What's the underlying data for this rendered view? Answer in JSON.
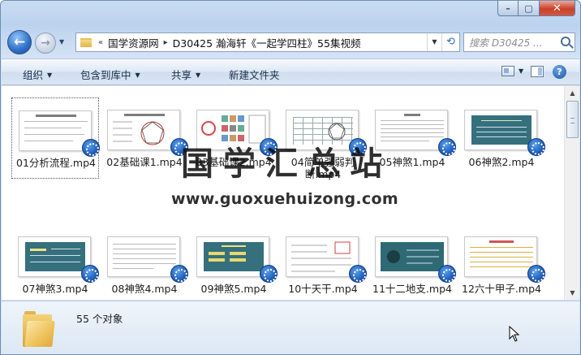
{
  "window": {
    "caption": {
      "minimize": "–",
      "maximize": "▢",
      "close": "✕"
    }
  },
  "nav": {
    "back_glyph": "←",
    "forward_glyph": "→",
    "breadcrumb": [
      "«",
      "国学资源网",
      "D30425 瀚海轩《一起学四柱》55集视频"
    ],
    "breadcrumb_sep": "▸",
    "refresh_glyph": "⟲",
    "search_placeholder": "搜索 D30425 ..."
  },
  "toolbar": {
    "organize": "组织",
    "include_in_library": "包含到库中",
    "share": "共享",
    "new_folder": "新建文件夹",
    "help": "?"
  },
  "files": [
    {
      "name": "01分析流程.mp4",
      "thumb": "text"
    },
    {
      "name": "02基础课1.mp4",
      "thumb": "diagram"
    },
    {
      "name": "03基础课2.mp4",
      "thumb": "grid"
    },
    {
      "name": "04简单强弱判断.mp4",
      "thumb": "grid"
    },
    {
      "name": "05神煞1.mp4",
      "thumb": "text"
    },
    {
      "name": "06神煞2.mp4",
      "thumb": "teal"
    },
    {
      "name": "07神煞3.mp4",
      "thumb": "teal"
    },
    {
      "name": "08神煞4.mp4",
      "thumb": "text"
    },
    {
      "name": "09神煞5.mp4",
      "thumb": "teal"
    },
    {
      "name": "10十天干.mp4",
      "thumb": "text"
    },
    {
      "name": "11十二地支.mp4",
      "thumb": "teal"
    },
    {
      "name": "12六十甲子.mp4",
      "thumb": "text"
    }
  ],
  "watermark": {
    "title": "国学汇总站",
    "url": "www.guoxuehuizong.com"
  },
  "details": {
    "count_text": "55 个对象"
  }
}
